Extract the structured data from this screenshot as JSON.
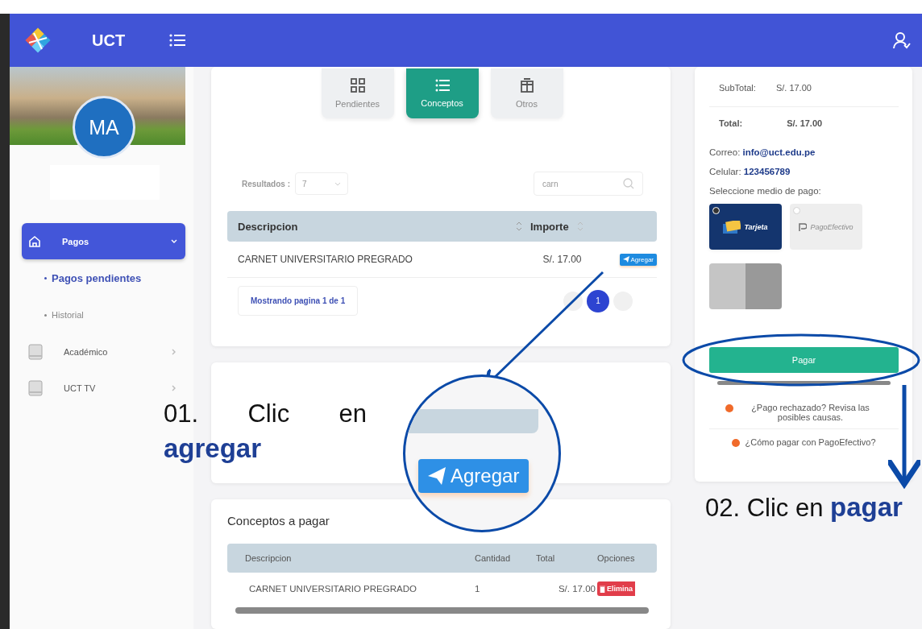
{
  "header": {
    "brand": "UCT"
  },
  "sidebar": {
    "avatar_initials": "MA",
    "menu": [
      {
        "label": "Pagos",
        "kind": "home",
        "selected": true,
        "expanded": true,
        "children": [
          {
            "label": "Pagos pendientes",
            "selected": true
          },
          {
            "label": "Historial",
            "selected": false
          }
        ]
      },
      {
        "label": "Académico",
        "kind": "book",
        "selected": false,
        "expanded": false
      },
      {
        "label": "UCT TV",
        "kind": "book",
        "selected": false,
        "expanded": false
      }
    ]
  },
  "tabs": [
    {
      "label": "Pendientes",
      "kind": "grid",
      "selected": false
    },
    {
      "label": "Conceptos",
      "kind": "list",
      "selected": true
    },
    {
      "label": "Otros",
      "kind": "gift",
      "selected": false
    }
  ],
  "filters": {
    "results_label": "Resultados :",
    "results_value": "7",
    "search_value": "carn"
  },
  "concepts_table": {
    "columns": [
      "Descripcion",
      "Importe"
    ],
    "rows": [
      {
        "description": "CARNET UNIVERSITARIO PREGRADO",
        "amount": "S/. 17.00",
        "action": "Agregar"
      }
    ]
  },
  "pagination": {
    "info": "Mostrando pagina 1 de 1",
    "pages": [
      {
        "label": "1",
        "selected": true
      }
    ]
  },
  "selected_concepts": {
    "title": "Conceptos a pagar",
    "columns": [
      "Descripcion",
      "Cantidad",
      "Total",
      "Opciones"
    ],
    "rows": [
      {
        "description": "CARNET UNIVERSITARIO PREGRADO",
        "quantity": "1",
        "total": "S/. 17.00",
        "action": "Elimina"
      }
    ]
  },
  "summary": {
    "subtotal_label": "SubTotal:",
    "subtotal": "S/. 17.00",
    "total_label": "Total:",
    "total": "S/. 17.00",
    "email": "Correo: **info@uct.edu.pe**",
    "phone": "Celular: **123456789**",
    "payment_prompt": "Seleccione medio de pago:",
    "payment_methods": [
      {
        "kind": "card",
        "label": "Tarjeta",
        "selected": true
      },
      {
        "kind": "cash",
        "label": "PagoEfectivo",
        "selected": false
      },
      {
        "kind": "wallet",
        "selected": false
      }
    ],
    "pay_button": "Pagar",
    "help_links": [
      "¿Pago rechazado? Revisa las posibles causas.",
      "¿Cómo pagar con PagoEfectivo?"
    ]
  },
  "annotations": {
    "steps": [
      {
        "text": "01. Clic en **agregar**"
      },
      {
        "text": "02. Clic en **pagar**"
      }
    ],
    "magnified_button": "Agregar"
  }
}
